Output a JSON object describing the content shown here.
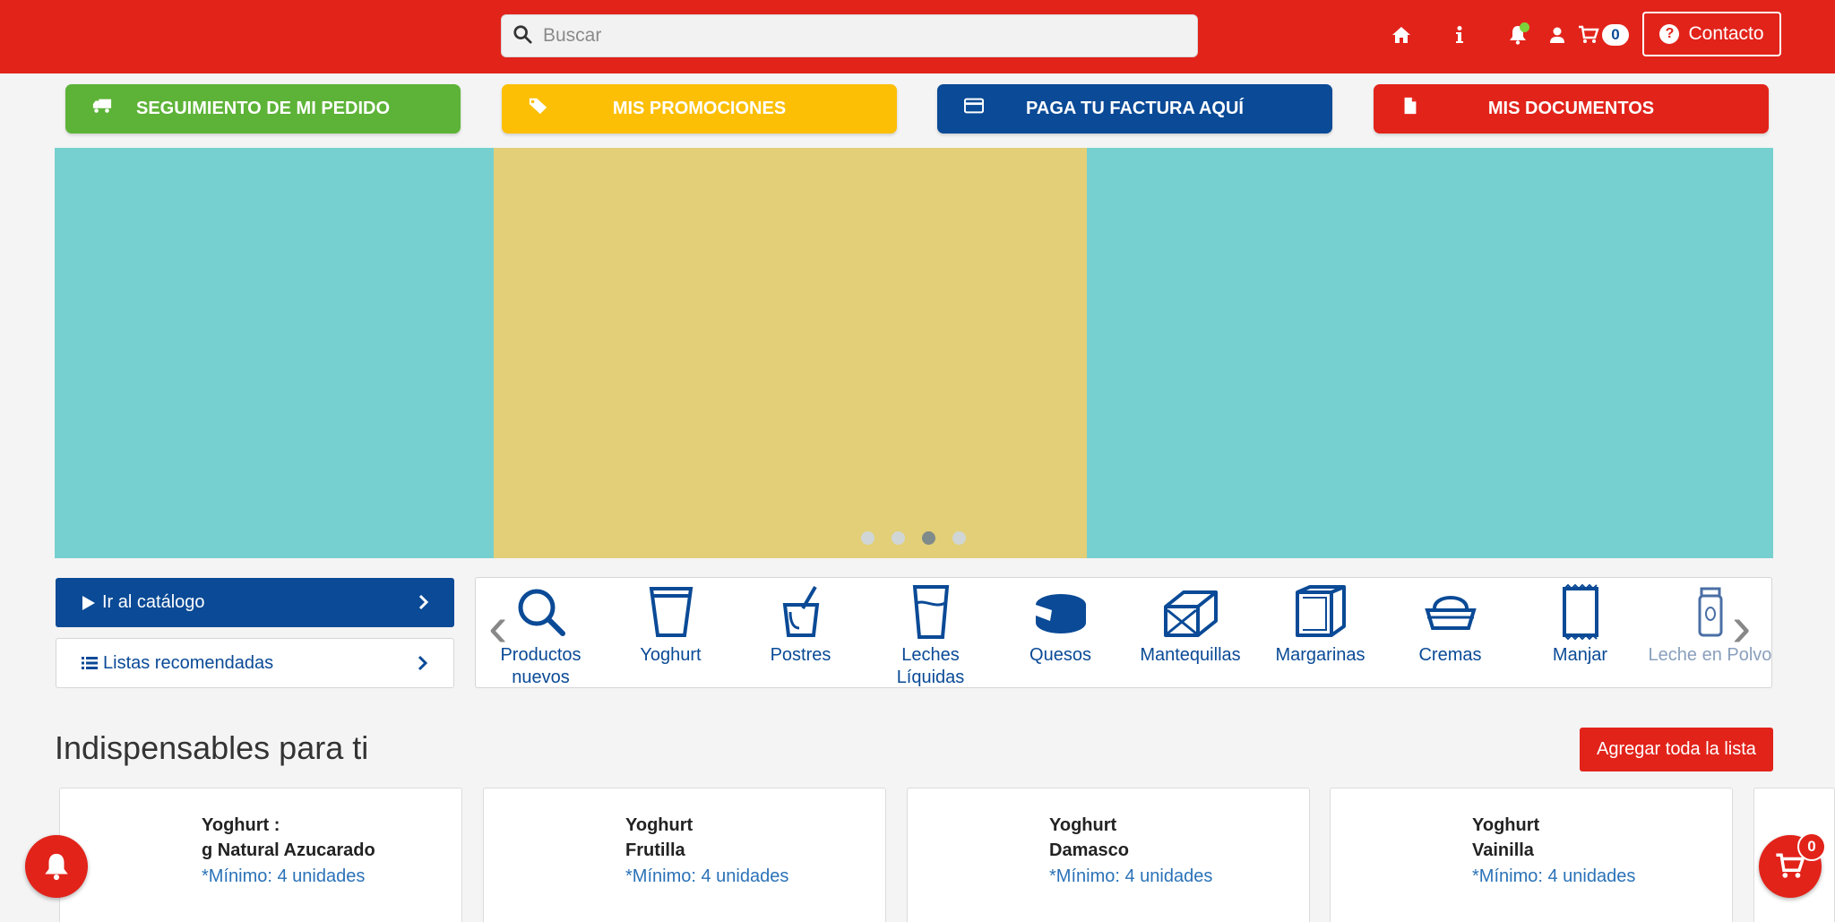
{
  "header": {
    "search_placeholder": "Buscar",
    "cart_count": "0",
    "contact_label": "Contacto"
  },
  "actions": [
    {
      "label": "SEGUIMIENTO DE MI PEDIDO",
      "icon": "truck-icon",
      "color": "#5db337"
    },
    {
      "label": "MIS PROMOCIONES",
      "icon": "tag-icon",
      "color": "#fcbf06"
    },
    {
      "label": "PAGA TU FACTURA AQUÍ",
      "icon": "credit-card-icon",
      "color": "#0a4a96"
    },
    {
      "label": "MIS DOCUMENTOS",
      "icon": "document-icon",
      "color": "#e2231a"
    }
  ],
  "banner": {
    "slide_count": 4,
    "active_slide": 3
  },
  "nav": {
    "catalog_label": "Ir al catálogo",
    "lists_label": "Listas recomendadas"
  },
  "categories": [
    {
      "label": "Productos nuevos",
      "icon": "search-icon"
    },
    {
      "label": "Yoghurt",
      "icon": "yoghurt-cup-icon"
    },
    {
      "label": "Postres",
      "icon": "dessert-cup-icon"
    },
    {
      "label": "Leches Líquidas",
      "icon": "milk-glass-icon"
    },
    {
      "label": "Quesos",
      "icon": "cheese-icon"
    },
    {
      "label": "Mantequillas",
      "icon": "butter-icon"
    },
    {
      "label": "Margarinas",
      "icon": "margarine-icon"
    },
    {
      "label": "Cremas",
      "icon": "cream-icon"
    },
    {
      "label": "Manjar",
      "icon": "manjar-packet-icon"
    },
    {
      "label": "Leche en Polvo",
      "icon": "powder-milk-icon"
    }
  ],
  "section": {
    "title": "Indispensables para ti",
    "add_all_label": "Agregar toda la lista"
  },
  "products": [
    {
      "line1": "Yoghurt :",
      "line2": "g Natural Azucarado",
      "min": "*Mínimo: 4 unidades"
    },
    {
      "line1": "Yoghurt",
      "line2": "Frutilla",
      "min": "*Mínimo: 4 unidades"
    },
    {
      "line1": "Yoghurt",
      "line2": "Damasco",
      "min": "*Mínimo: 4 unidades"
    },
    {
      "line1": "Yoghurt",
      "line2": "Vainilla",
      "min": "*Mínimo: 4 unidades"
    }
  ],
  "floating": {
    "cart_count": "0"
  },
  "colors": {
    "brand_red": "#e2231a",
    "brand_blue": "#0a4a96",
    "banner_teal": "#76d0cf",
    "banner_yellow": "#e2cf77"
  }
}
